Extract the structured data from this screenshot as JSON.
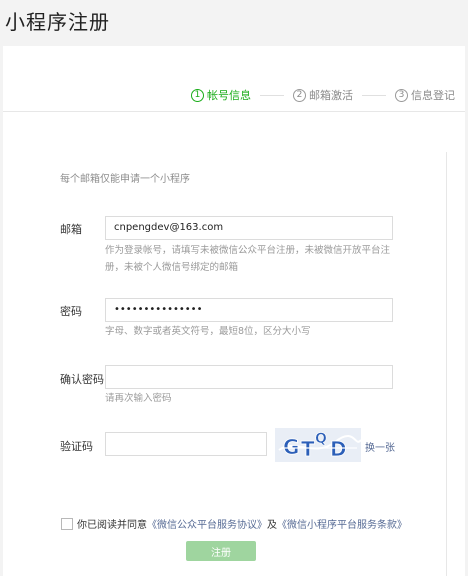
{
  "page": {
    "title": "小程序注册"
  },
  "steps": [
    {
      "num": "1",
      "label": "帐号信息"
    },
    {
      "num": "2",
      "label": "邮箱激活"
    },
    {
      "num": "3",
      "label": "信息登记"
    }
  ],
  "notice": "每个邮箱仅能申请一个小程序",
  "email": {
    "label": "邮箱",
    "value": "cnpengdev@163.com",
    "hint_line1": "作为登录帐号，请填写未被微信公众平台注册，未被微信开放平台注",
    "hint_line2": "册，未被个人微信号绑定的邮箱"
  },
  "password": {
    "label": "密码",
    "value": "•••••••••••••••",
    "hint": "字母、数字或者英文符号，最短8位，区分大小写"
  },
  "confirm_password": {
    "label": "确认密码",
    "value": "",
    "hint": "请再次输入密码"
  },
  "captcha": {
    "label": "验证码",
    "value": "",
    "image_text": "GTQD",
    "refresh": "换一张"
  },
  "agreement": {
    "prefix": "你已阅读并同意",
    "link1": "《微信公众平台服务协议》",
    "conj": "及",
    "link2": "《微信小程序平台服务条款》",
    "checked": false
  },
  "submit_label": "注册",
  "colors": {
    "accent": "#1aad19",
    "link": "#576b95",
    "button_disabled": "#9fd59f"
  }
}
